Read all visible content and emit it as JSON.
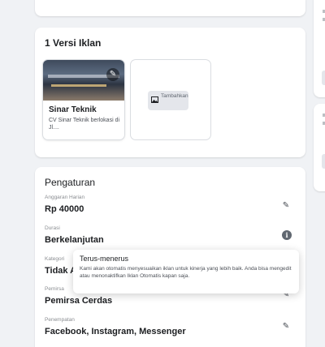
{
  "versions": {
    "title": "1 Versi Iklan",
    "ad": {
      "name": "Sinar Teknik",
      "description": "CV Sinar Teknik berlokasi di Jl...."
    },
    "add_label": "Tambahkan"
  },
  "settings": {
    "title": "Pengaturan",
    "fields": [
      {
        "label": "Anggaran Harian",
        "value": "Rp 40000",
        "icon": "pencil-icon"
      },
      {
        "label": "Durasi",
        "value": "Berkelanjutan",
        "icon": "info-icon"
      },
      {
        "label": "Kategori",
        "value": "Tidak A",
        "icon": "pencil-icon"
      },
      {
        "label": "Pemirsa",
        "value": "Pemirsa Cerdas",
        "icon": "pencil-icon"
      },
      {
        "label": "Penempatan",
        "value": "Facebook, Instagram, Messenger",
        "icon": "pencil-icon"
      }
    ]
  },
  "tooltip": {
    "title": "Terus-menerus",
    "body": "Kami akan otomatis menyesuaikan iklan untuk kinerja yang lebih baik. Anda bisa mengedit atau menonaktifkan Iklan Otomatis kapan saja."
  }
}
